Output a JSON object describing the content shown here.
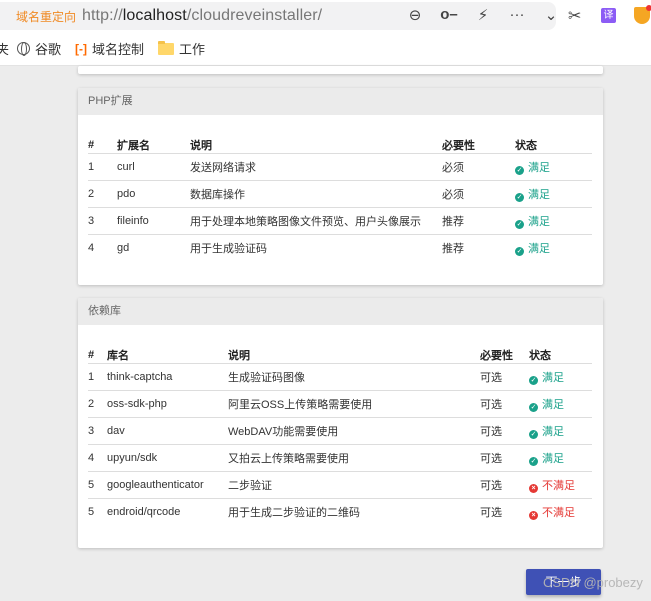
{
  "browser": {
    "redirect_label": "域名重定向",
    "url_prefix": "http://",
    "url_host": "localhost",
    "url_path": "/cloudreveinstaller/",
    "icons": [
      "zoom-out-icon",
      "key-icon",
      "lightning-icon",
      "more-icon",
      "chevron-down-icon"
    ],
    "extensions": [
      "scissors-icon",
      "translate-icon",
      "shield-extension-icon"
    ],
    "translate_glyph": "译"
  },
  "bookmarks": [
    {
      "label": "夹",
      "icon": "none"
    },
    {
      "label": "谷歌",
      "icon": "globe-icon"
    },
    {
      "label": "域名控制",
      "icon": "aliyun-icon"
    },
    {
      "label": "工作",
      "icon": "folder-icon"
    }
  ],
  "php_extensions": {
    "title": "PHP扩展",
    "headers": [
      "#",
      "扩展名",
      "说明",
      "必要性",
      "状态"
    ],
    "rows": [
      {
        "num": "1",
        "name": "curl",
        "desc": "发送网络请求",
        "req": "必须",
        "status": "满足",
        "ok": true
      },
      {
        "num": "2",
        "name": "pdo",
        "desc": "数据库操作",
        "req": "必须",
        "status": "满足",
        "ok": true
      },
      {
        "num": "3",
        "name": "fileinfo",
        "desc": "用于处理本地策略图像文件预览、用户头像展示",
        "req": "推荐",
        "status": "满足",
        "ok": true
      },
      {
        "num": "4",
        "name": "gd",
        "desc": "用于生成验证码",
        "req": "推荐",
        "status": "满足",
        "ok": true
      }
    ]
  },
  "dependencies": {
    "title": "依赖库",
    "headers": [
      "#",
      "库名",
      "说明",
      "必要性",
      "状态"
    ],
    "rows": [
      {
        "num": "1",
        "name": "think-captcha",
        "desc": "生成验证码图像",
        "req": "可选",
        "status": "满足",
        "ok": true
      },
      {
        "num": "2",
        "name": "oss-sdk-php",
        "desc": "阿里云OSS上传策略需要使用",
        "req": "可选",
        "status": "满足",
        "ok": true
      },
      {
        "num": "3",
        "name": "dav",
        "desc": "WebDAV功能需要使用",
        "req": "可选",
        "status": "满足",
        "ok": true
      },
      {
        "num": "4",
        "name": "upyun/sdk",
        "desc": "又拍云上传策略需要使用",
        "req": "可选",
        "status": "满足",
        "ok": true
      },
      {
        "num": "5",
        "name": "googleauthenticator",
        "desc": "二步验证",
        "req": "可选",
        "status": "不满足",
        "ok": false
      },
      {
        "num": "5",
        "name": "endroid/qrcode",
        "desc": "用于生成二步验证的二维码",
        "req": "可选",
        "status": "不满足",
        "ok": false
      }
    ]
  },
  "actions": {
    "next_label": "下一步"
  },
  "watermark": "CSDN @probezy",
  "colors": {
    "ok": "#1aa18a",
    "bad": "#e53935",
    "primary": "#3f51b5"
  }
}
